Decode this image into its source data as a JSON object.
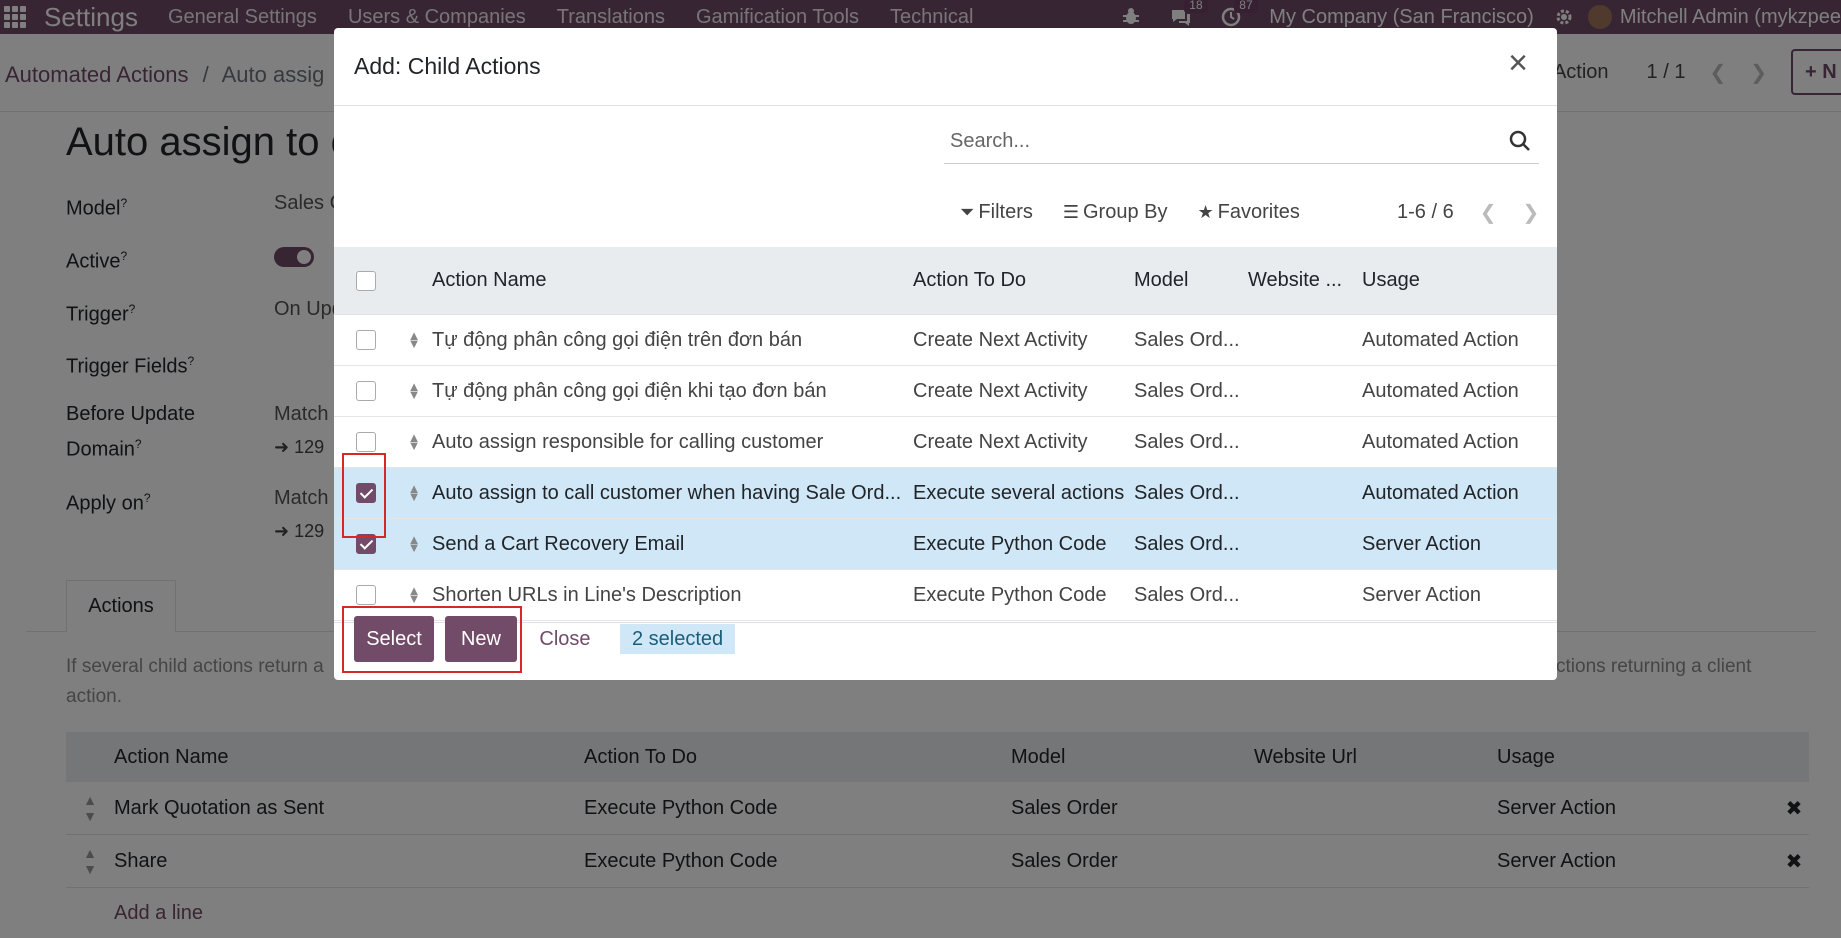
{
  "navbar": {
    "brand": "Settings",
    "menu": [
      "General Settings",
      "Users & Companies",
      "Translations",
      "Gamification Tools",
      "Technical"
    ],
    "messages_count": "18",
    "activities_count": "87",
    "company": "My Company (San Francisco)",
    "user": "Mitchell Admin (mykzpee"
  },
  "control_panel": {
    "breadcrumb_root": "Automated Actions",
    "breadcrumb_sep": "/",
    "breadcrumb_current": "Auto assig",
    "action_label": "Action",
    "pager": "1 / 1",
    "new_label": "+ N"
  },
  "form": {
    "title": "Auto assign to c",
    "fields": [
      {
        "label": "Model",
        "value": "Sales C"
      },
      {
        "label": "Active",
        "value": ""
      },
      {
        "label": "Trigger",
        "value": "On Upd"
      },
      {
        "label": "Trigger Fields",
        "value": ""
      },
      {
        "label": "Before Update Domain",
        "value": "Match"
      },
      {
        "label": "Apply on",
        "value": "Match"
      }
    ],
    "before_domain_records": "129",
    "apply_on_records": "129",
    "tab_actions": "Actions",
    "help_text_left": "If several child actions return a",
    "help_text_right": "ctions returning a client",
    "help_text_line2": "action."
  },
  "child_actions": {
    "headers": [
      "Action Name",
      "Action To Do",
      "Model",
      "Website Url",
      "Usage"
    ],
    "rows": [
      {
        "name": "Mark Quotation as Sent",
        "todo": "Execute Python Code",
        "model": "Sales Order",
        "url": "",
        "usage": "Server Action"
      },
      {
        "name": "Share",
        "todo": "Execute Python Code",
        "model": "Sales Order",
        "url": "",
        "usage": "Server Action"
      }
    ],
    "add_line": "Add a line"
  },
  "modal": {
    "title": "Add: Child Actions",
    "search_placeholder": "Search...",
    "filters_label": "Filters",
    "group_by_label": "Group By",
    "favorites_label": "Favorites",
    "pager": "1-6 / 6",
    "headers": [
      "Action Name",
      "Action To Do",
      "Model",
      "Website ...",
      "Usage"
    ],
    "rows": [
      {
        "name": "Tự động phân công gọi điện trên đơn bán",
        "todo": "Create Next Activity",
        "model": "Sales Ord...",
        "url": "",
        "usage": "Automated Action",
        "selected": false
      },
      {
        "name": "Tự động phân công gọi điện khi tạo đơn bán",
        "todo": "Create Next Activity",
        "model": "Sales Ord...",
        "url": "",
        "usage": "Automated Action",
        "selected": false
      },
      {
        "name": "Auto assign responsible for calling customer",
        "todo": "Create Next Activity",
        "model": "Sales Ord...",
        "url": "",
        "usage": "Automated Action",
        "selected": false
      },
      {
        "name": "Auto assign to call customer when having Sale Ord...",
        "todo": "Execute several actions",
        "model": "Sales Ord...",
        "url": "",
        "usage": "Automated Action",
        "selected": true
      },
      {
        "name": "Send a Cart Recovery Email",
        "todo": "Execute Python Code",
        "model": "Sales Ord...",
        "url": "",
        "usage": "Server Action",
        "selected": true
      },
      {
        "name": "Shorten URLs in Line's Description",
        "todo": "Execute Python Code",
        "model": "Sales Ord...",
        "url": "",
        "usage": "Server Action",
        "selected": false
      }
    ],
    "select_label": "Select",
    "new_label": "New",
    "close_label": "Close",
    "selected_text": "2 selected"
  },
  "colors": {
    "brand": "#714B67",
    "selection": "#cfe7f6",
    "highlight_box": "#d62828"
  }
}
